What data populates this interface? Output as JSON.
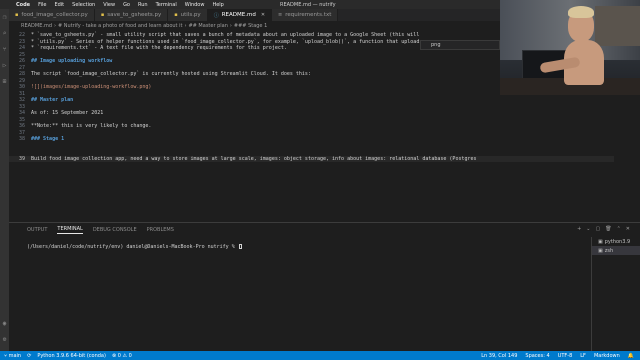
{
  "menubar": {
    "app": "Code",
    "items": [
      "File",
      "Edit",
      "Selection",
      "View",
      "Go",
      "Run",
      "Terminal",
      "Window",
      "Help"
    ],
    "window_title": "README.md — nutrify"
  },
  "tabs": [
    {
      "icon": "python-file-icon",
      "label": "food_image_collector.py",
      "active": false
    },
    {
      "icon": "python-file-icon",
      "label": "save_to_gsheets.py",
      "active": false
    },
    {
      "icon": "python-file-icon",
      "label": "utils.py",
      "active": false
    },
    {
      "icon": "markdown-file-icon",
      "label": "README.md",
      "active": true
    },
    {
      "icon": "text-file-icon",
      "label": "requirements.txt",
      "active": false
    }
  ],
  "breadcrumb": [
    "README.md",
    "# Nutrify - take a photo of food and learn about it",
    "## Master plan",
    "### Stage 1"
  ],
  "find_widget": {
    "query": "png"
  },
  "editor": {
    "lines": [
      {
        "n": "22",
        "segments": [
          {
            "t": "* `save_to_gsheets.py` - small utility script that saves a bunch of metadata about an uploaded image to a Google Sheet (this will",
            "c": "plain"
          }
        ]
      },
      {
        "n": "23",
        "segments": [
          {
            "t": "* `utils.py` - Series of helper functions used in `food_image_collector.py`, for example, `upload_blob()`, a function that uploads",
            "c": "plain"
          }
        ]
      },
      {
        "n": "24",
        "segments": [
          {
            "t": "* `requirements.txt` - A text file with the dependency requirements for this project.",
            "c": "plain"
          }
        ]
      },
      {
        "n": "25",
        "segments": []
      },
      {
        "n": "26",
        "segments": [
          {
            "t": "## Image uploading workflow",
            "c": "head"
          }
        ]
      },
      {
        "n": "27",
        "segments": []
      },
      {
        "n": "28",
        "segments": [
          {
            "t": "The script `food_image_collector.py` is currently hosted using Streamlit Cloud. It does this:",
            "c": "plain"
          }
        ]
      },
      {
        "n": "29",
        "segments": []
      },
      {
        "n": "30",
        "segments": [
          {
            "t": "![](images/image-uploading-workflow.png)",
            "c": "str"
          }
        ]
      },
      {
        "n": "31",
        "segments": []
      },
      {
        "n": "32",
        "segments": [
          {
            "t": "## Master plan",
            "c": "head"
          }
        ]
      },
      {
        "n": "33",
        "segments": []
      },
      {
        "n": "34",
        "segments": [
          {
            "t": "As of: 15 September 2021",
            "c": "plain"
          }
        ]
      },
      {
        "n": "35",
        "segments": []
      },
      {
        "n": "36",
        "segments": [
          {
            "t": "**Note:** this is very likely to change.",
            "c": "plain"
          }
        ]
      },
      {
        "n": "37",
        "segments": []
      },
      {
        "n": "38",
        "segments": [
          {
            "t": "### Stage 1",
            "c": "head"
          }
        ]
      },
      {
        "n": "39",
        "segments": [
          {
            "t": "",
            "c": "plain"
          }
        ]
      },
      {
        "n": "39",
        "segments": [
          {
            "t": "Build food image collection app, need a way to store images at large scale, images: object storage, info about images: relational database (Postgres",
            "c": "plain"
          }
        ],
        "current": true
      }
    ]
  },
  "panel": {
    "tabs": [
      "OUTPUT",
      "TERMINAL",
      "DEBUG CONSOLE",
      "PROBLEMS"
    ],
    "active_tab": "TERMINAL",
    "actions": [
      "+",
      "⌄",
      "▢",
      "🗑",
      "⌃",
      "✕"
    ],
    "terminal_prompt": "(/Users/daniel/code/nutrify/env) daniel@Daniels-MacBook-Pro nutrify % ",
    "terminals": [
      {
        "label": "python3.9",
        "active": false
      },
      {
        "label": "zsh",
        "active": true
      }
    ]
  },
  "statusbar": {
    "branch": "main",
    "sync": "⟳",
    "interpreter": "Python 3.9.6 64-bit (conda)",
    "errors": "⊗ 0 ⚠ 0",
    "position": "Ln 39, Col 149",
    "spaces": "Spaces: 4",
    "encoding": "UTF-8",
    "eol": "LF",
    "language": "Markdown"
  },
  "colors": {
    "accent": "#007acc",
    "heading": "#569cd6",
    "string": "#ce9178"
  }
}
